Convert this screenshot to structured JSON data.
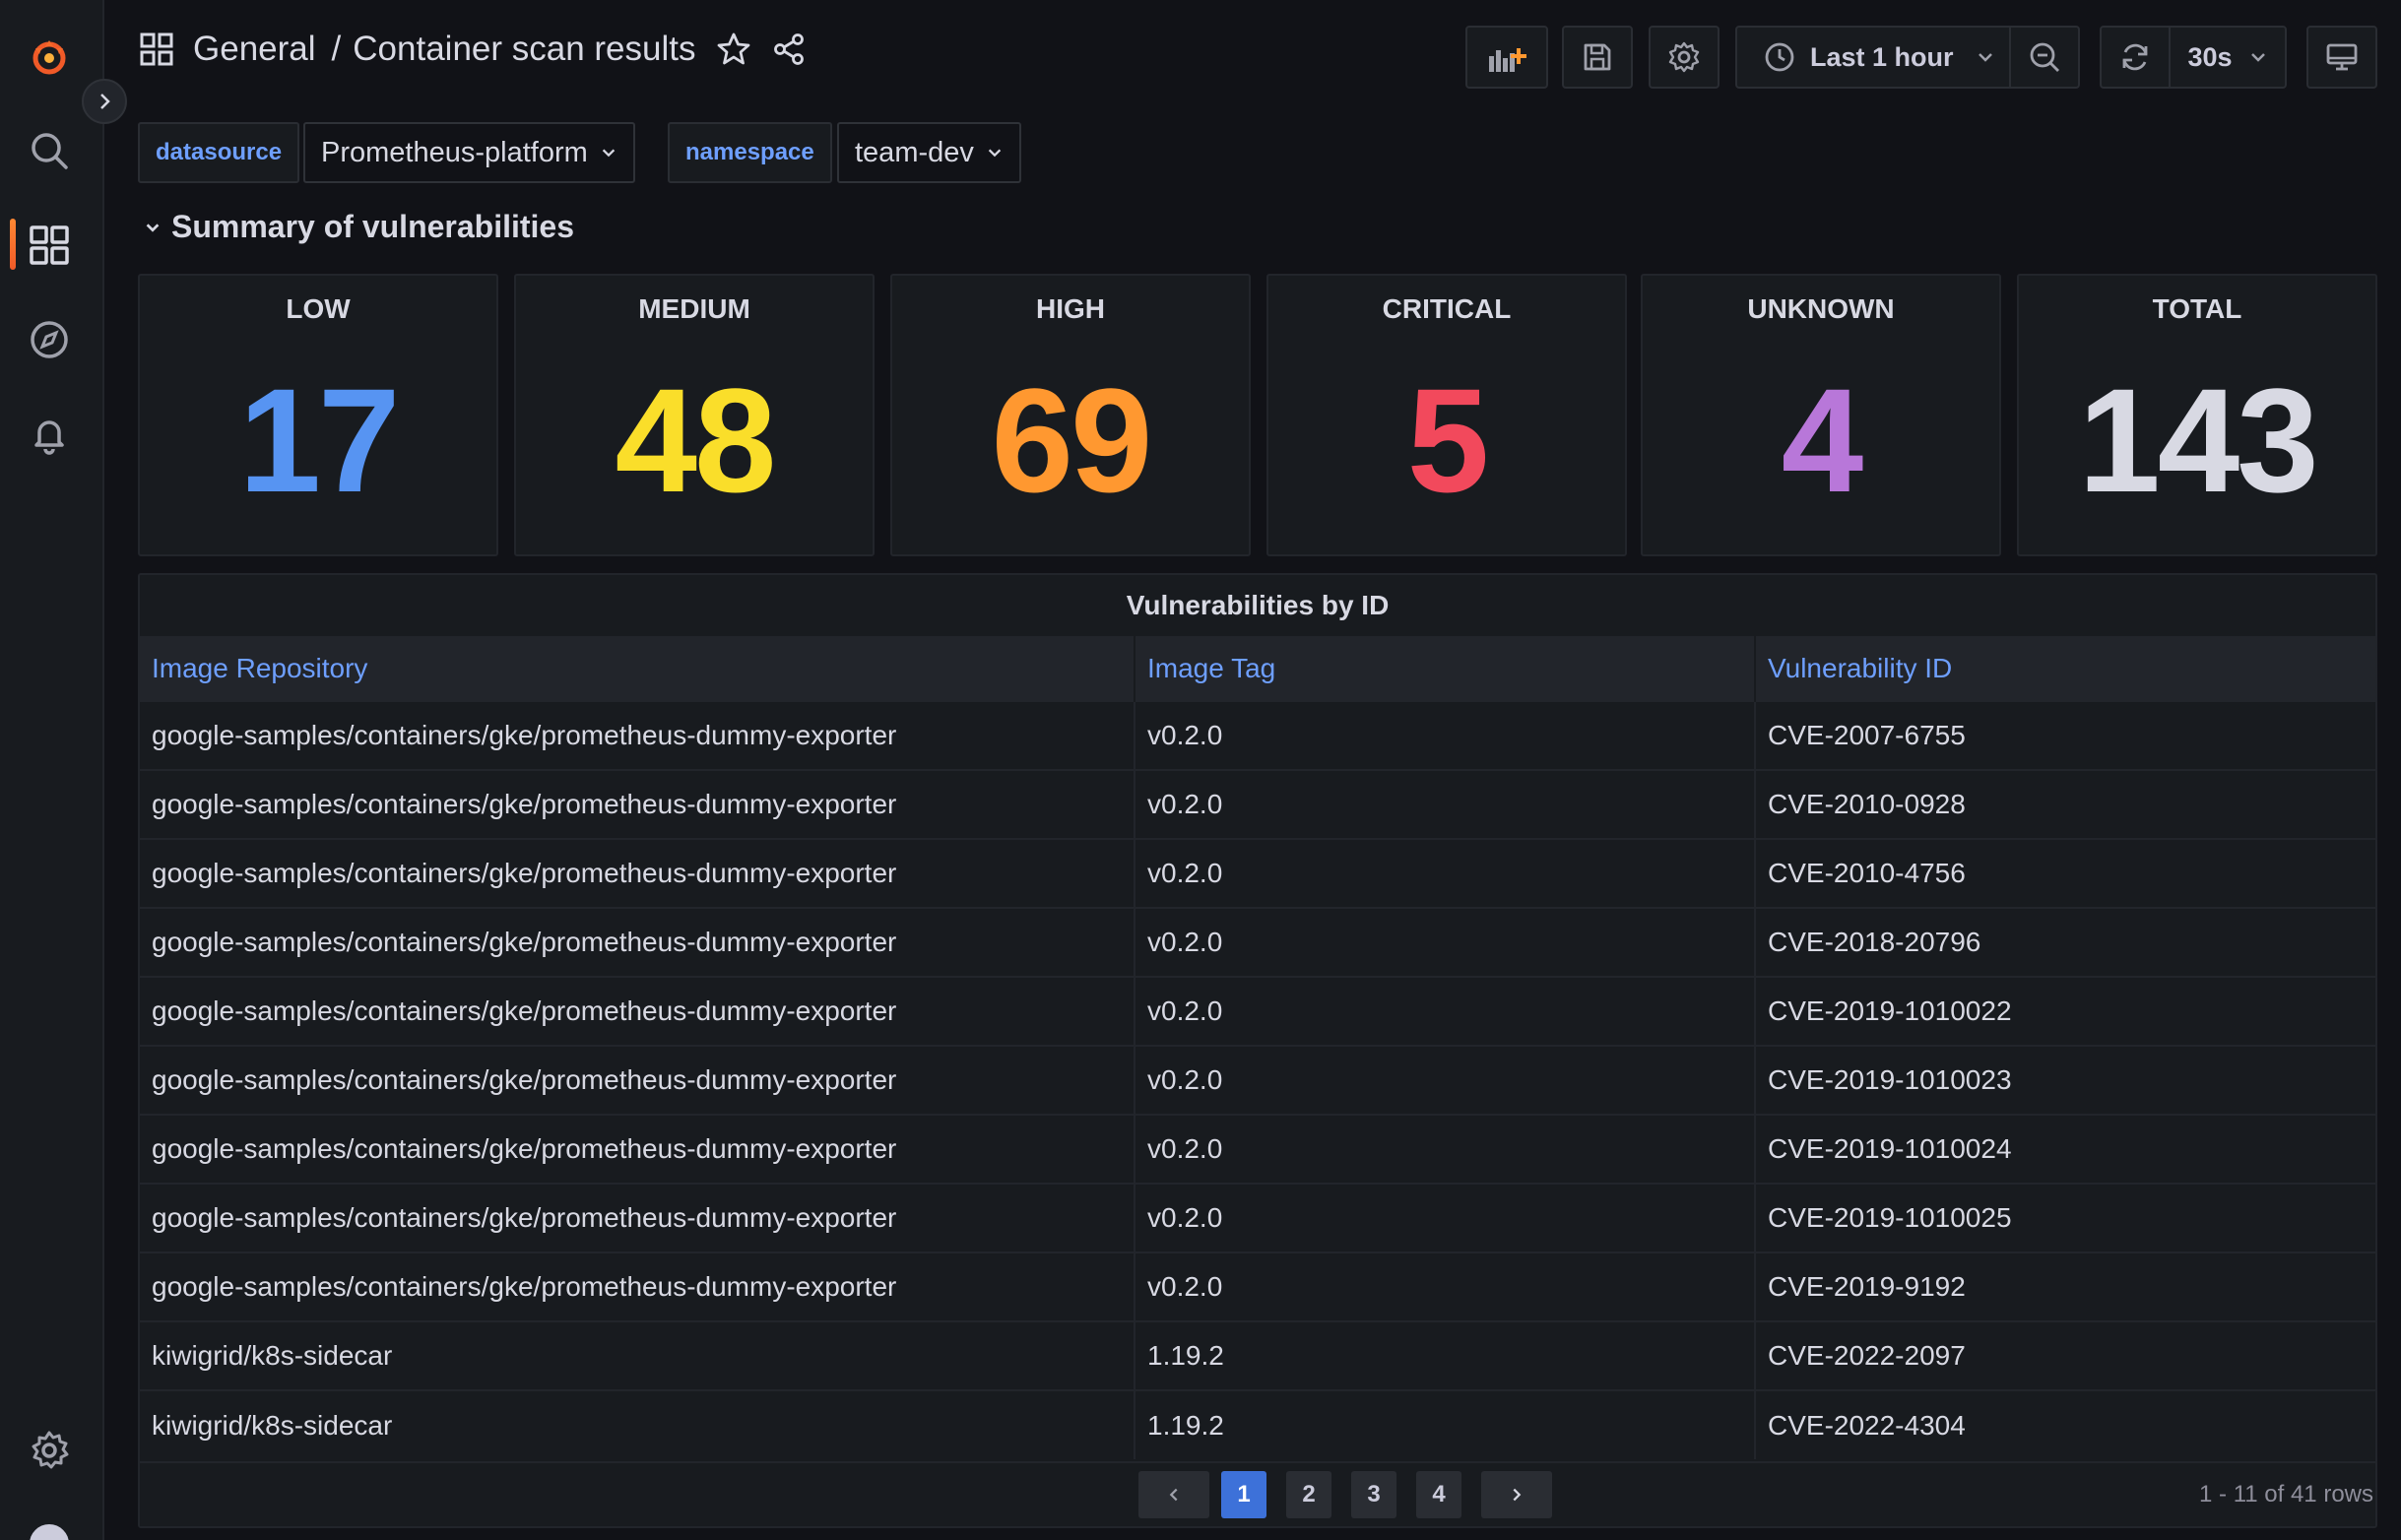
{
  "breadcrumb": {
    "folder": "General",
    "separator": "/",
    "title": "Container scan results"
  },
  "toolbar": {
    "time_range": "Last 1 hour",
    "refresh_interval": "30s"
  },
  "variables": [
    {
      "label": "datasource",
      "value": "Prometheus-platform"
    },
    {
      "label": "namespace",
      "value": "team-dev"
    }
  ],
  "row": {
    "title": "Summary of vulnerabilities"
  },
  "stats": [
    {
      "title": "LOW",
      "value": "17",
      "color": "#5794f2"
    },
    {
      "title": "MEDIUM",
      "value": "48",
      "color": "#fade2a"
    },
    {
      "title": "HIGH",
      "value": "69",
      "color": "#ff9830"
    },
    {
      "title": "CRITICAL",
      "value": "5",
      "color": "#f2495c"
    },
    {
      "title": "UNKNOWN",
      "value": "4",
      "color": "#b877d9"
    },
    {
      "title": "TOTAL",
      "value": "143",
      "color": "#d8d9e3"
    }
  ],
  "table": {
    "title": "Vulnerabilities by ID",
    "columns": [
      "Image Repository",
      "Image Tag",
      "Vulnerability ID"
    ],
    "rows": [
      [
        "google-samples/containers/gke/prometheus-dummy-exporter",
        "v0.2.0",
        "CVE-2007-6755"
      ],
      [
        "google-samples/containers/gke/prometheus-dummy-exporter",
        "v0.2.0",
        "CVE-2010-0928"
      ],
      [
        "google-samples/containers/gke/prometheus-dummy-exporter",
        "v0.2.0",
        "CVE-2010-4756"
      ],
      [
        "google-samples/containers/gke/prometheus-dummy-exporter",
        "v0.2.0",
        "CVE-2018-20796"
      ],
      [
        "google-samples/containers/gke/prometheus-dummy-exporter",
        "v0.2.0",
        "CVE-2019-1010022"
      ],
      [
        "google-samples/containers/gke/prometheus-dummy-exporter",
        "v0.2.0",
        "CVE-2019-1010023"
      ],
      [
        "google-samples/containers/gke/prometheus-dummy-exporter",
        "v0.2.0",
        "CVE-2019-1010024"
      ],
      [
        "google-samples/containers/gke/prometheus-dummy-exporter",
        "v0.2.0",
        "CVE-2019-1010025"
      ],
      [
        "google-samples/containers/gke/prometheus-dummy-exporter",
        "v0.2.0",
        "CVE-2019-9192"
      ],
      [
        "kiwigrid/k8s-sidecar",
        "1.19.2",
        "CVE-2022-2097"
      ],
      [
        "kiwigrid/k8s-sidecar",
        "1.19.2",
        "CVE-2022-4304"
      ]
    ],
    "pages": [
      "1",
      "2",
      "3",
      "4"
    ],
    "active_page": "1",
    "row_count": "1 - 11 of 41 rows"
  },
  "icons": {
    "sidebar": [
      "grafana-logo-icon",
      "search-icon",
      "dashboards-icon",
      "explore-icon",
      "alerting-icon",
      "settings-icon"
    ],
    "toolbar": [
      "add-panel-icon",
      "save-icon",
      "settings-icon",
      "clock-icon",
      "zoom-out-icon",
      "refresh-icon",
      "tv-mode-icon"
    ]
  },
  "colors": {
    "accent": "#3d71d9",
    "link": "#6e9fff",
    "brand": "#f05a28"
  }
}
